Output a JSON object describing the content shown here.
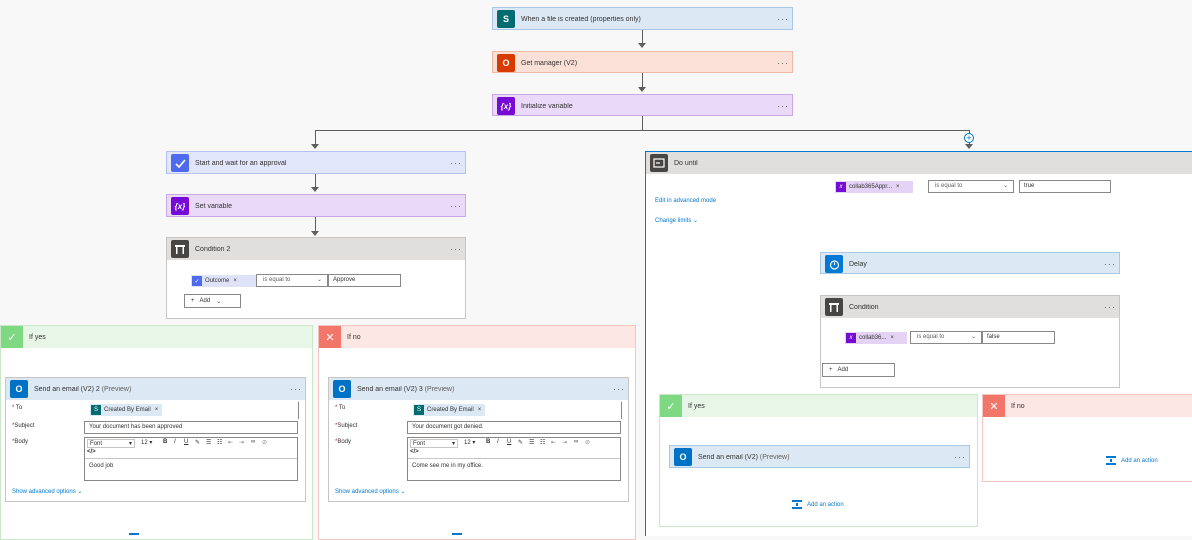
{
  "colors": {
    "sharepoint": "#036c70",
    "office": "#d83b01",
    "variable": "#770bd6",
    "approval": "#4f6bed",
    "condition": "#484644",
    "outlook": "#0072c6",
    "delay": "#0078d4",
    "doUntil": "#484644",
    "yes": "#7fd882",
    "no": "#f2776a"
  },
  "menu_dots": "···",
  "trigger": {
    "title": "When a file is created (properties only)",
    "icon": "sharepoint-icon",
    "glyph": "S"
  },
  "get_manager": {
    "title": "Get manager (V2)",
    "icon": "office-icon",
    "glyph": "O"
  },
  "init_var": {
    "title": "Initialize variable",
    "icon": "variable-icon",
    "glyph": "{x}"
  },
  "approval": {
    "title": "Start and wait for an approval",
    "icon": "approval-icon"
  },
  "set_var": {
    "title": "Set variable",
    "glyph": "{x}"
  },
  "condition2": {
    "title": "Condition 2",
    "token": "Outcome",
    "operator": "is equal to",
    "value": "Approve",
    "add_label": "Add"
  },
  "left_yes": {
    "label": "If yes",
    "email": {
      "title": "Send an email (V2) 2",
      "preview": "(Preview)",
      "to_label": "To",
      "to_token": "Created By Email",
      "subject_label": "Subject",
      "subject": "Your document has been approved",
      "body_label": "Body",
      "font": "Font",
      "size": "12",
      "body": "Good job",
      "advanced": "Show advanced options"
    }
  },
  "left_no": {
    "label": "If no",
    "email": {
      "title": "Send an email (V2) 3",
      "preview": "(Preview)",
      "to_label": "To",
      "to_token": "Created By Email",
      "subject_label": "Subject",
      "subject": "Your document got denied.",
      "body_label": "Body",
      "font": "Font",
      "size": "12",
      "body": "Come see me in my office.",
      "advanced": "Show advanced options"
    }
  },
  "do_until": {
    "title": "Do until",
    "token": "collab365Appr...",
    "operator": "is equal to",
    "value": "true",
    "edit_advanced": "Edit in advanced mode",
    "change_limits": "Change limits"
  },
  "delay": {
    "title": "Delay"
  },
  "condition": {
    "title": "Condition",
    "token": "collab36...",
    "operator": "is equal to",
    "value": "false",
    "add_label": "Add"
  },
  "right_yes": {
    "label": "If yes",
    "email": {
      "title": "Send an email (V2)",
      "preview": "(Preview)"
    },
    "add_action": "Add an action"
  },
  "right_no": {
    "label": "If no",
    "add_action": "Add an action"
  }
}
